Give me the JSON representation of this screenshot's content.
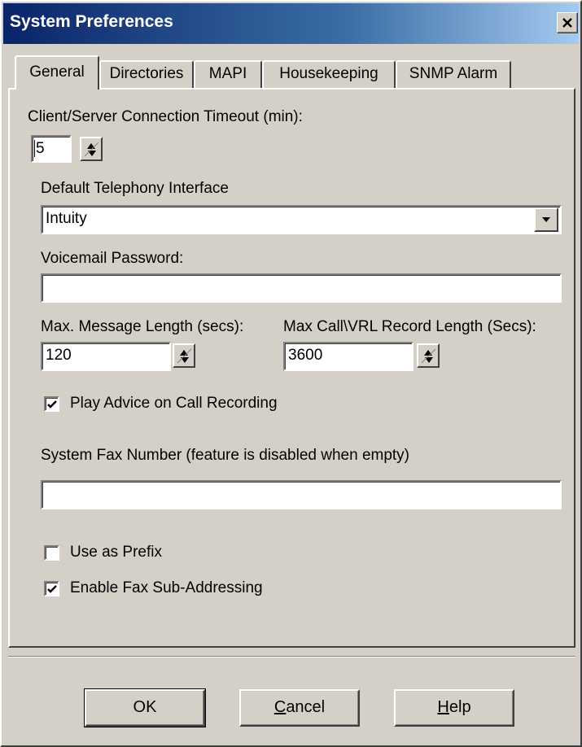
{
  "window": {
    "title": "System Preferences",
    "close_glyph": "✕",
    "close_icon": "close-icon"
  },
  "tabs": [
    {
      "label": "General",
      "active": true
    },
    {
      "label": "Directories",
      "active": false
    },
    {
      "label": "MAPI",
      "active": false
    },
    {
      "label": "Housekeeping",
      "active": false
    },
    {
      "label": "SNMP Alarm",
      "active": false
    }
  ],
  "general": {
    "timeout_label": "Client/Server Connection Timeout (min):",
    "timeout_value": "5",
    "telephony_label": "Default Telephony Interface",
    "telephony_value": "Intuity",
    "voicemail_label": "Voicemail Password:",
    "voicemail_value": "",
    "max_msg_label": "Max. Message Length (secs):",
    "max_msg_value": "120",
    "max_call_label": "Max Call\\VRL Record Length (Secs):",
    "max_call_value": "3600",
    "play_advice_label": "Play Advice on Call Recording",
    "play_advice_checked": true,
    "fax_number_label": "System Fax Number (feature is disabled when empty)",
    "fax_number_value": "",
    "use_prefix_label": "Use as Prefix",
    "use_prefix_checked": false,
    "fax_sub_label": "Enable Fax Sub-Addressing",
    "fax_sub_checked": true
  },
  "buttons": {
    "ok": "OK",
    "cancel_first": "C",
    "cancel_rest": "ancel",
    "help_first": "H",
    "help_rest": "elp"
  },
  "colors": {
    "titlebar_start": "#0a246a",
    "titlebar_end": "#a6caf0",
    "face": "#d4d0c8"
  }
}
